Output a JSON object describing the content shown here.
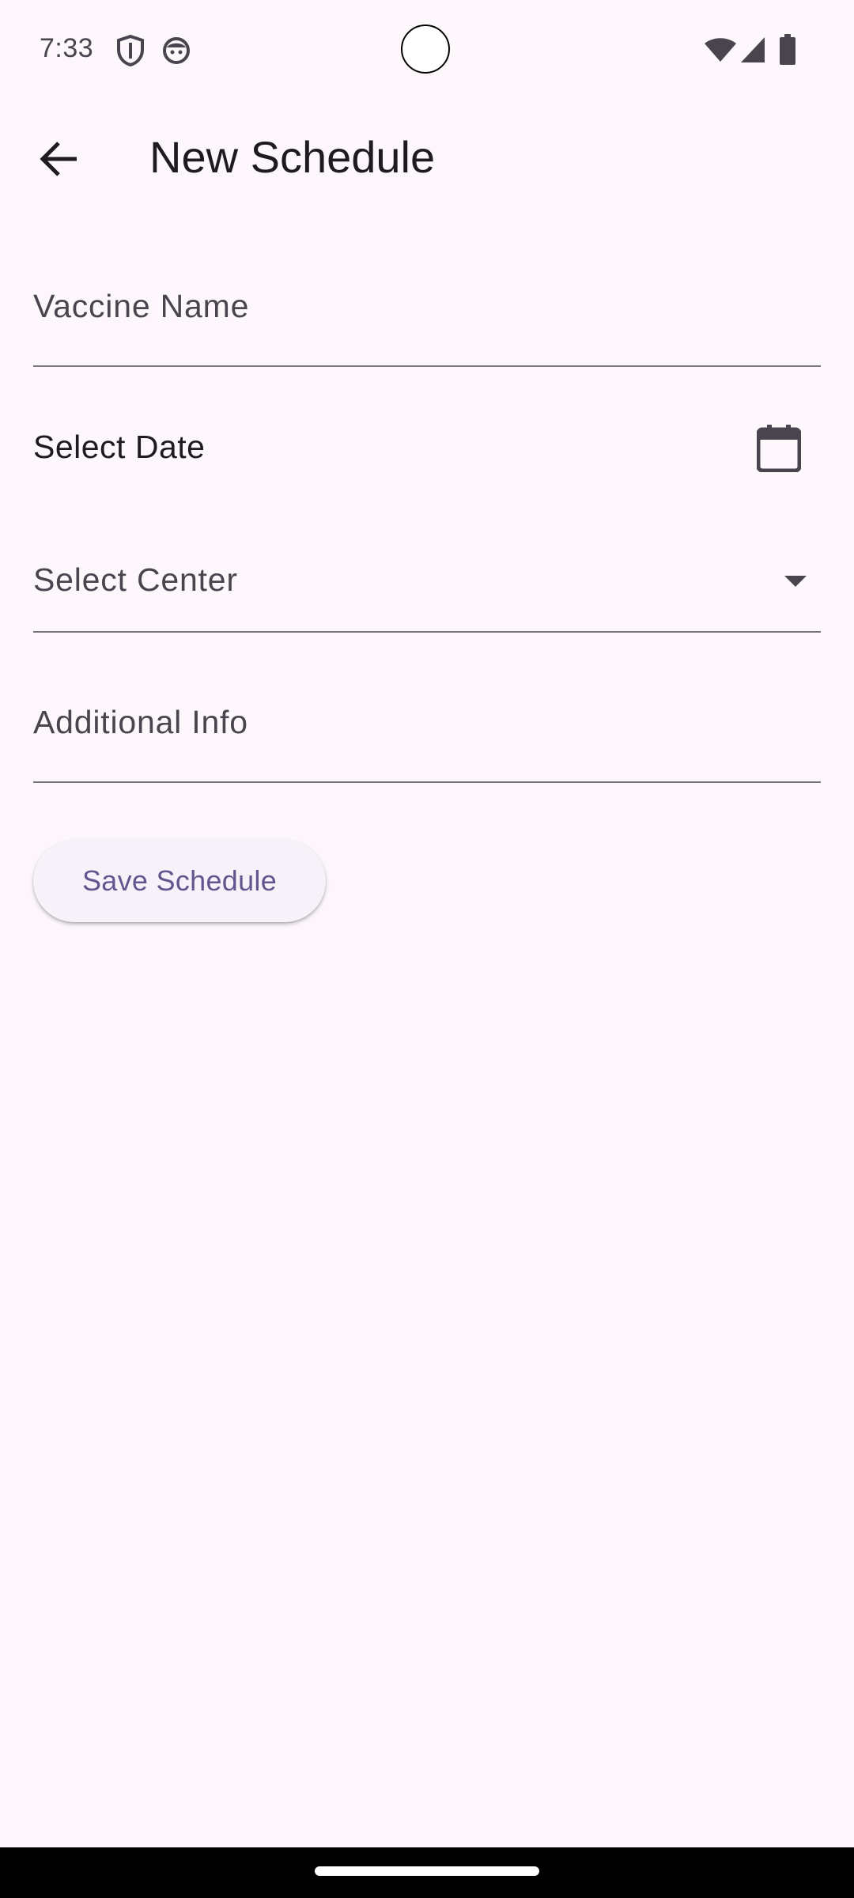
{
  "status_bar": {
    "time": "7:33",
    "left_icons": [
      "shield-icon",
      "face-icon"
    ],
    "right_icons": [
      "wifi-icon",
      "cellular-icon",
      "battery-icon"
    ]
  },
  "app_bar": {
    "back_icon": "arrow-back-icon",
    "title": "New Schedule"
  },
  "form": {
    "vaccine_name": {
      "label": "Vaccine Name",
      "value": ""
    },
    "date": {
      "label": "Select Date",
      "icon": "calendar-icon"
    },
    "center": {
      "label": "Select Center",
      "icon": "dropdown-arrow-icon"
    },
    "additional_info": {
      "label": "Additional Info",
      "value": ""
    },
    "save_label": "Save Schedule"
  },
  "colors": {
    "background": "#FDF7FC",
    "primary": "#65558F",
    "on_surface": "#1D1B20",
    "on_surface_variant": "#49454F",
    "outline": "#79747E",
    "button_surface": "#F7F2FA"
  }
}
